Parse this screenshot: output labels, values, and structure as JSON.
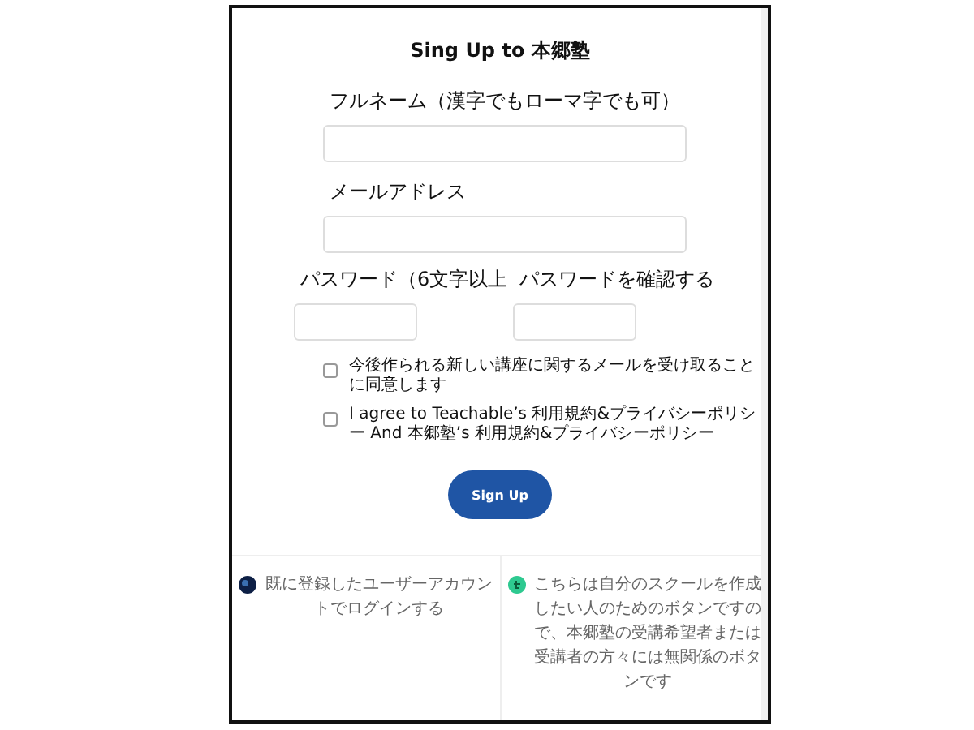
{
  "title": "Sing Up to 本郷塾",
  "fields": [
    {
      "label": "フルネーム（漢字でもローマ字でも可）",
      "kind": "full"
    },
    {
      "label": "メールアドレス",
      "kind": "full"
    },
    {
      "label": "パスワード（6文字以上",
      "kind": "half"
    },
    {
      "label": "パスワードを確認する",
      "kind": "half"
    }
  ],
  "agreements": [
    {
      "text": "今後作られる新しい講座に関するメールを受け取ることに同意します",
      "checked": false
    },
    {
      "text": "I agree to Teachable’s 利用規約&プライバシーポリシー And 本郷塾’s 利用規約&プライバシーポリシー",
      "checked": false
    }
  ],
  "submit_button": "Sign Up",
  "footer_links": [
    {
      "text": "既に登録したユーザーアカウントでログインする"
    },
    {
      "text": "こちらは自分のスクールを作成したい人のためのボタンですので、本郷塾の受講希望者または受講者の方々には無関係のボタンです"
    }
  ]
}
